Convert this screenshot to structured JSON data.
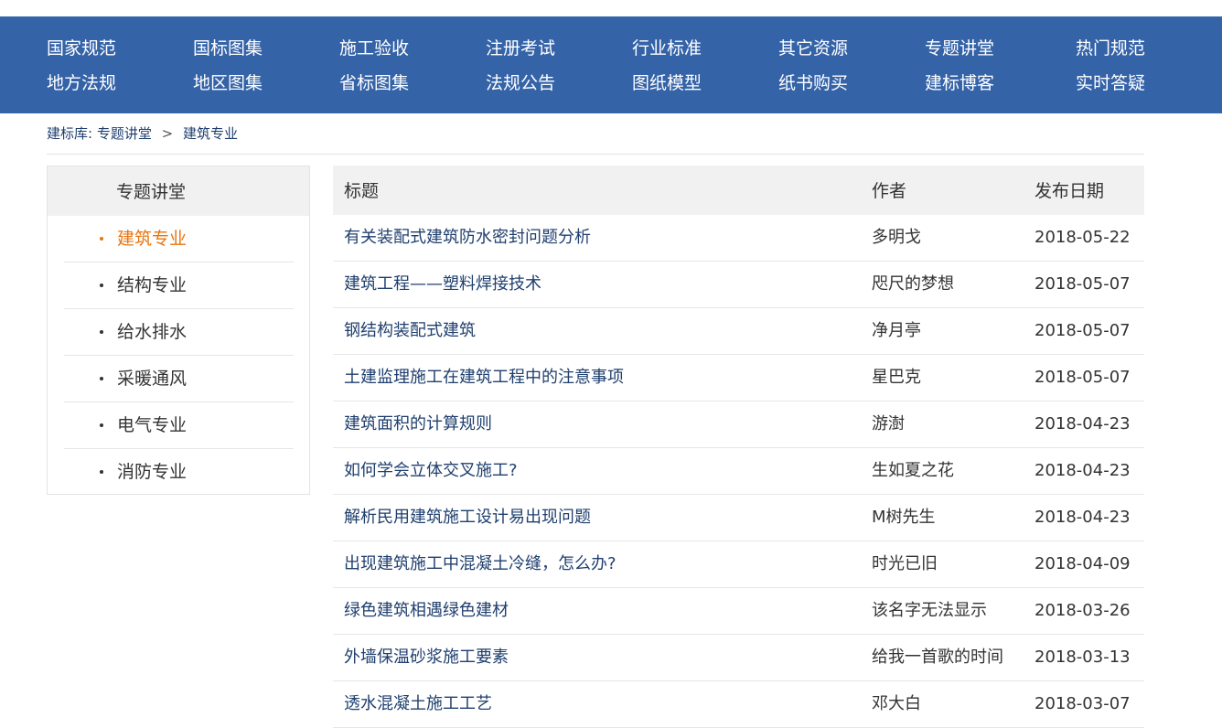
{
  "nav": {
    "row1": [
      "国家规范",
      "国标图集",
      "施工验收",
      "注册考试",
      "行业标准",
      "其它资源",
      "专题讲堂",
      "热门规范"
    ],
    "row2": [
      "地方法规",
      "地区图集",
      "省标图集",
      "法规公告",
      "图纸模型",
      "纸书购买",
      "建标博客",
      "实时答疑"
    ],
    "background_color": "#3463a8"
  },
  "breadcrumb": {
    "root": "建标库:",
    "section": "专题讲堂",
    "separator": ">",
    "current": "建筑专业"
  },
  "sidebar": {
    "title": "专题讲堂",
    "active_color": "#e8750f",
    "items": [
      {
        "label": "建筑专业",
        "active": true
      },
      {
        "label": "结构专业",
        "active": false
      },
      {
        "label": "给水排水",
        "active": false
      },
      {
        "label": "采暖通风",
        "active": false
      },
      {
        "label": "电气专业",
        "active": false
      },
      {
        "label": "消防专业",
        "active": false
      }
    ]
  },
  "table": {
    "headers": {
      "title": "标题",
      "author": "作者",
      "date": "发布日期"
    },
    "rows": [
      {
        "title": "有关装配式建筑防水密封问题分析",
        "author": "多明戈",
        "date": "2018-05-22"
      },
      {
        "title": "建筑工程——塑料焊接技术",
        "author": "咫尺的梦想",
        "date": "2018-05-07"
      },
      {
        "title": "钢结构装配式建筑",
        "author": "净月亭",
        "date": "2018-05-07"
      },
      {
        "title": "土建监理施工在建筑工程中的注意事项",
        "author": "星巴克",
        "date": "2018-05-07"
      },
      {
        "title": "建筑面积的计算规则",
        "author": "游澍",
        "date": "2018-04-23"
      },
      {
        "title": "如何学会立体交叉施工?",
        "author": "生如夏之花",
        "date": "2018-04-23"
      },
      {
        "title": "解析民用建筑施工设计易出现问题",
        "author": "M树先生",
        "date": "2018-04-23"
      },
      {
        "title": "出现建筑施工中混凝土冷缝，怎么办?",
        "author": "时光已旧",
        "date": "2018-04-09"
      },
      {
        "title": "绿色建筑相遇绿色建材",
        "author": "该名字无法显示",
        "date": "2018-03-26"
      },
      {
        "title": "外墙保温砂浆施工要素",
        "author": "给我一首歌的时间",
        "date": "2018-03-13"
      },
      {
        "title": "透水混凝土施工工艺",
        "author": "邓大白",
        "date": "2018-03-07"
      }
    ]
  }
}
